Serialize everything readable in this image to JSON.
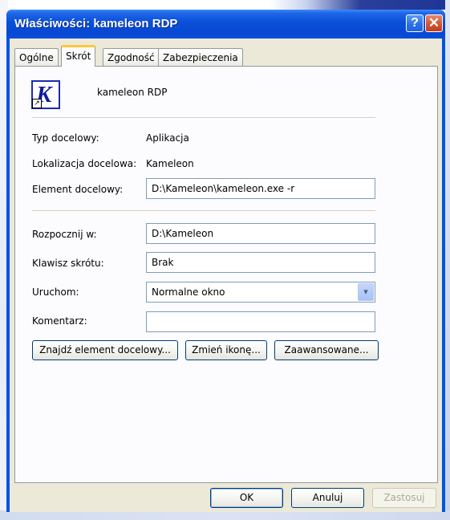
{
  "window": {
    "title": "Właściwości: kameleon RDP",
    "help_label": "?",
    "close_label": "✕"
  },
  "tabs": [
    {
      "label": "Ogólne",
      "active": false
    },
    {
      "label": "Skrót",
      "active": true
    },
    {
      "label": "Zgodność",
      "active": false
    },
    {
      "label": "Zabezpieczenia",
      "active": false
    }
  ],
  "shortcut": {
    "icon": "kameleon-app-icon",
    "icon_letter": "K",
    "name": "kameleon RDP",
    "target_type_label": "Typ docelowy:",
    "target_type_value": "Aplikacja",
    "target_location_label": "Lokalizacja docelowa:",
    "target_location_value": "Kameleon",
    "target_label": "Element docelowy:",
    "target_value": "D:\\Kameleon\\kameleon.exe -r",
    "start_in_label": "Rozpocznij w:",
    "start_in_value": "D:\\Kameleon",
    "hotkey_label": "Klawisz skrótu:",
    "hotkey_value": "Brak",
    "run_label": "Uruchom:",
    "run_value": "Normalne okno",
    "comment_label": "Komentarz:",
    "comment_value": "",
    "find_target_button": "Znajdź element docelowy...",
    "change_icon_button": "Zmień ikonę...",
    "advanced_button": "Zaawansowane..."
  },
  "footer": {
    "ok": "OK",
    "cancel": "Anuluj",
    "apply": "Zastosuj"
  },
  "colors": {
    "titlebar": "#0a4fd8",
    "dialog_bg": "#ece9d8",
    "active_tab_accent": "#ffc83c"
  }
}
